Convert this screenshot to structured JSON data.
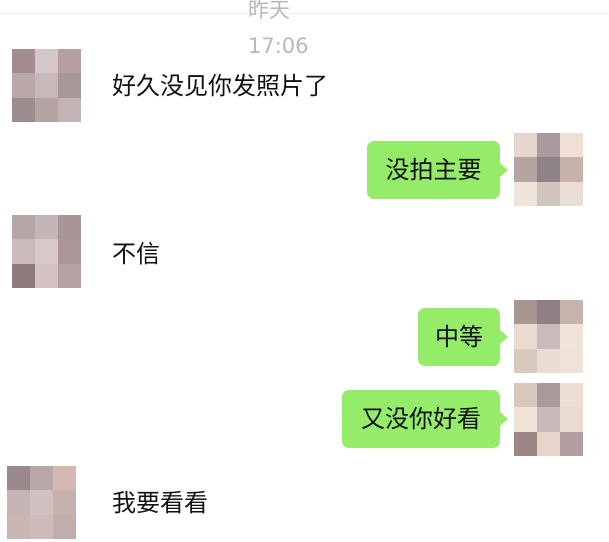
{
  "chat": {
    "timestamp": "昨天 17:06",
    "messages": [
      {
        "side": "left",
        "text": "好久没见你发照片了"
      },
      {
        "side": "right",
        "text": "没拍主要"
      },
      {
        "side": "left",
        "text": "不信"
      },
      {
        "side": "right",
        "text": "中等"
      },
      {
        "side": "right",
        "text": "又没你好看"
      },
      {
        "side": "left",
        "text": "我要看看"
      }
    ]
  },
  "colors": {
    "sent_bubble": "#95ec69",
    "background": "#ffffff"
  }
}
